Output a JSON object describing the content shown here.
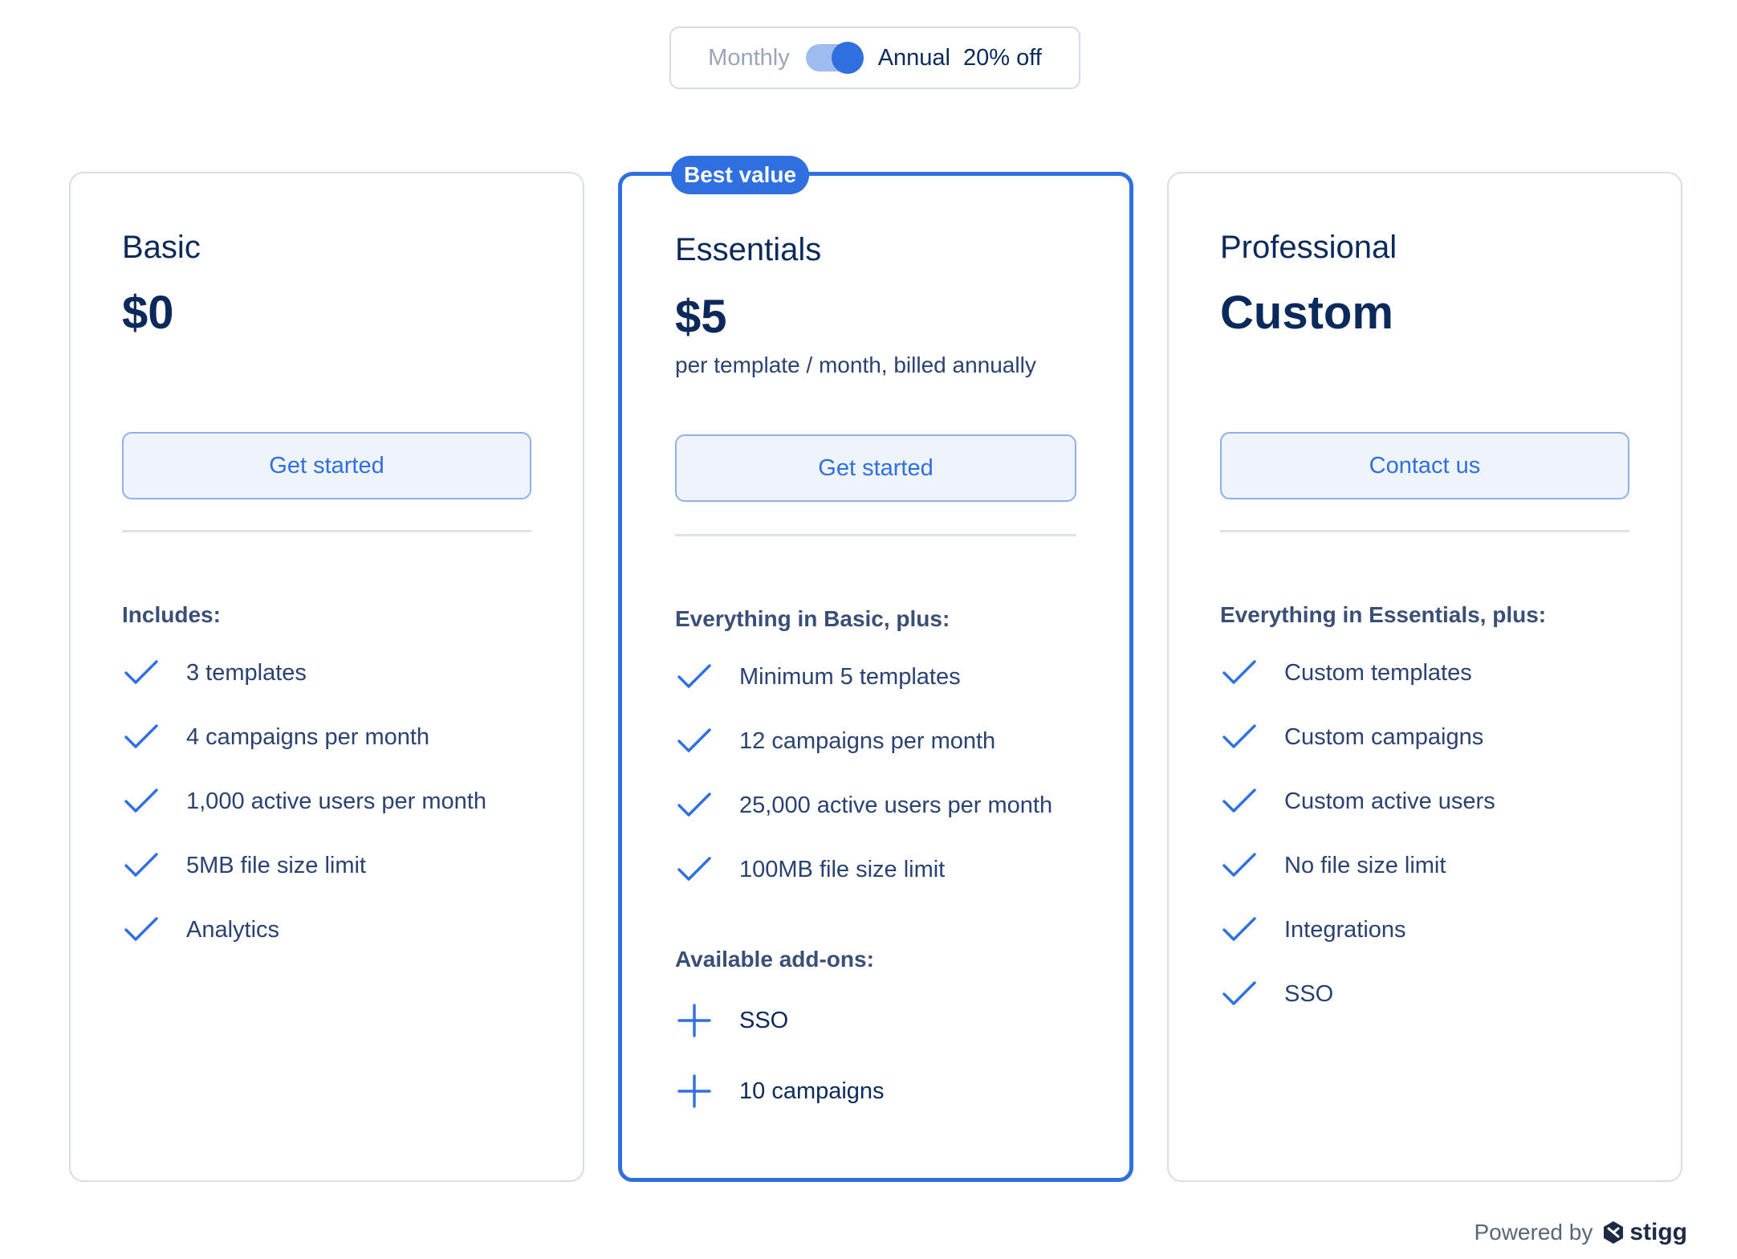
{
  "billing_toggle": {
    "monthly_label": "Monthly",
    "annual_label": "Annual",
    "discount_label": "20% off",
    "selected": "Annual"
  },
  "colors": {
    "accent": "#2f6fdf",
    "text_dark": "#0b2a5b",
    "text_muted": "#9aa6b8",
    "card_border": "#d9dde4",
    "button_bg": "#eef3fc"
  },
  "plans": [
    {
      "name": "Basic",
      "price": "$0",
      "price_note": "",
      "cta_label": "Get started",
      "features_heading": "Includes:",
      "features": [
        "3 templates",
        "4 campaigns per month",
        "1,000 active users per month",
        "5MB file size limit",
        "Analytics"
      ],
      "feature_icon": "check-icon"
    },
    {
      "name": "Essentials",
      "badge": "Best value",
      "price": "$5",
      "price_note": "per template / month, billed annually",
      "cta_label": "Get started",
      "features_heading": "Everything in Basic, plus:",
      "features": [
        "Minimum 5 templates",
        "12 campaigns per month",
        "25,000 active users per month",
        "100MB file size limit"
      ],
      "feature_icon": "check-icon",
      "addons_heading": "Available add-ons:",
      "addons": [
        "SSO",
        "10 campaigns"
      ],
      "addon_icon": "plus-icon"
    },
    {
      "name": "Professional",
      "price": "Custom",
      "price_note": "",
      "cta_label": "Contact us",
      "features_heading": "Everything in Essentials, plus:",
      "features": [
        "Custom templates",
        "Custom campaigns",
        "Custom active users",
        "No file size limit",
        "Integrations",
        "SSO"
      ],
      "feature_icon": "check-icon"
    }
  ],
  "footer": {
    "powered_by": "Powered by",
    "brand": "stigg",
    "brand_icon": "stigg-logo-icon"
  }
}
